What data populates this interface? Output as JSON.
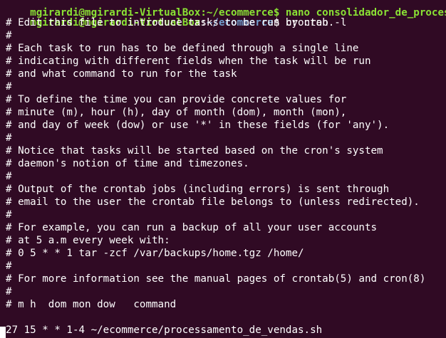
{
  "terminal": {
    "scrolled_line": "mgirardi@mgirardi-VirtualBox:~/ecommerce$ nano consolidador_de_processamento_",
    "prompt": {
      "user_host": "mgirardi@mgirardi-VirtualBox",
      "separator": ":",
      "path": "~/ecommerce",
      "symbol": "$ ",
      "command": "crontab -l"
    },
    "lines": [
      "# Edit this file to introduce tasks to be run by cron.",
      "#",
      "# Each task to run has to be defined through a single line",
      "# indicating with different fields when the task will be run",
      "# and what command to run for the task",
      "#",
      "# To define the time you can provide concrete values for",
      "# minute (m), hour (h), day of month (dom), month (mon),",
      "# and day of week (dow) or use '*' in these fields (for 'any').",
      "#",
      "# Notice that tasks will be started based on the cron's system",
      "# daemon's notion of time and timezones.",
      "#",
      "# Output of the crontab jobs (including errors) is sent through",
      "# email to the user the crontab file belongs to (unless redirected).",
      "#",
      "# For example, you can run a backup of all your user accounts",
      "# at 5 a.m every week with:",
      "# 0 5 * * 1 tar -zcf /var/backups/home.tgz /home/",
      "#",
      "# For more information see the manual pages of crontab(5) and cron(8)",
      "#",
      "# m h  dom mon dow   command",
      "",
      "27 15 * * 1-4 ~/ecommerce/processamento_de_vendas.sh"
    ],
    "colors": {
      "background": "#300a24",
      "user_host": "#8ae234",
      "path": "#729fcf",
      "text": "#ffffff"
    }
  }
}
